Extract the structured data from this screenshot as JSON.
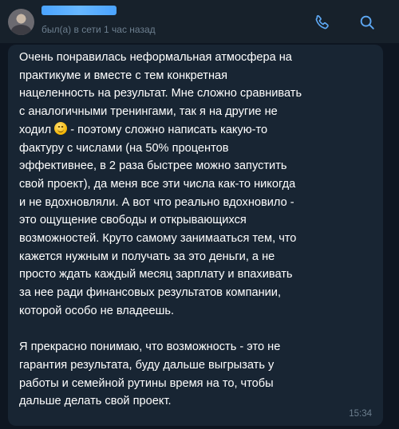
{
  "header": {
    "status": "был(а) в сети 1 час назад",
    "call_icon": "phone-icon",
    "search_icon": "search-icon",
    "accent_color": "#5ea9f5"
  },
  "message": {
    "text_part1": "Очень понравилась неформальная атмосфера на\nпрактикуме и вместе с тем конкретная\nнацеленность на результат. Мне сложно сравнивать\nс аналогичными тренингами, так я на другие не\nходил ",
    "emoji": "slightly-smiling-face-emoji",
    "text_part2": " - поэтому сложно написать какую-то\nфактуру с числами (на 50% процентов\nэффективнее, в 2 раза быстрее можно запустить\nсвой проект), да меня все эти числа как-то никогда\nи не вдохновляли. А вот что реально вдохновило -\nэто ощущение свободы и открывающихся\nвозможностей. Круто самому занимааться тем, что\nкажется нужным и получать за это деньги, а не\nпросто ждать каждый месяц зарплату и впахивать\nза нее ради финансовых результатов компании,\nкоторой особо не владеешь.\n\nЯ прекрасно понимаю, что возможность - это не\nгарантия результата, буду дальше выгрызать у\nработы и семейной рутины время на то, чтобы\nдальше делать свой проект.",
    "time": "15:34"
  }
}
